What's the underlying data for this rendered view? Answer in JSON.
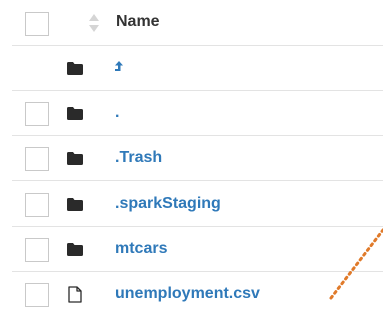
{
  "header": {
    "name_label": "Name"
  },
  "rows": [
    {
      "kind": "parent",
      "label": "",
      "icon": "folder-icon"
    },
    {
      "kind": "folder",
      "label": ".",
      "icon": "folder-icon"
    },
    {
      "kind": "folder",
      "label": ".Trash",
      "icon": "folder-icon"
    },
    {
      "kind": "folder",
      "label": ".sparkStaging",
      "icon": "folder-icon"
    },
    {
      "kind": "folder",
      "label": "mtcars",
      "icon": "folder-icon"
    },
    {
      "kind": "file",
      "label": "unemployment.csv",
      "icon": "file-icon"
    }
  ],
  "colors": {
    "link": "#2f79b9",
    "header_text": "#333333",
    "divider": "#e3e3e3",
    "annotation": "#e07a2a"
  }
}
